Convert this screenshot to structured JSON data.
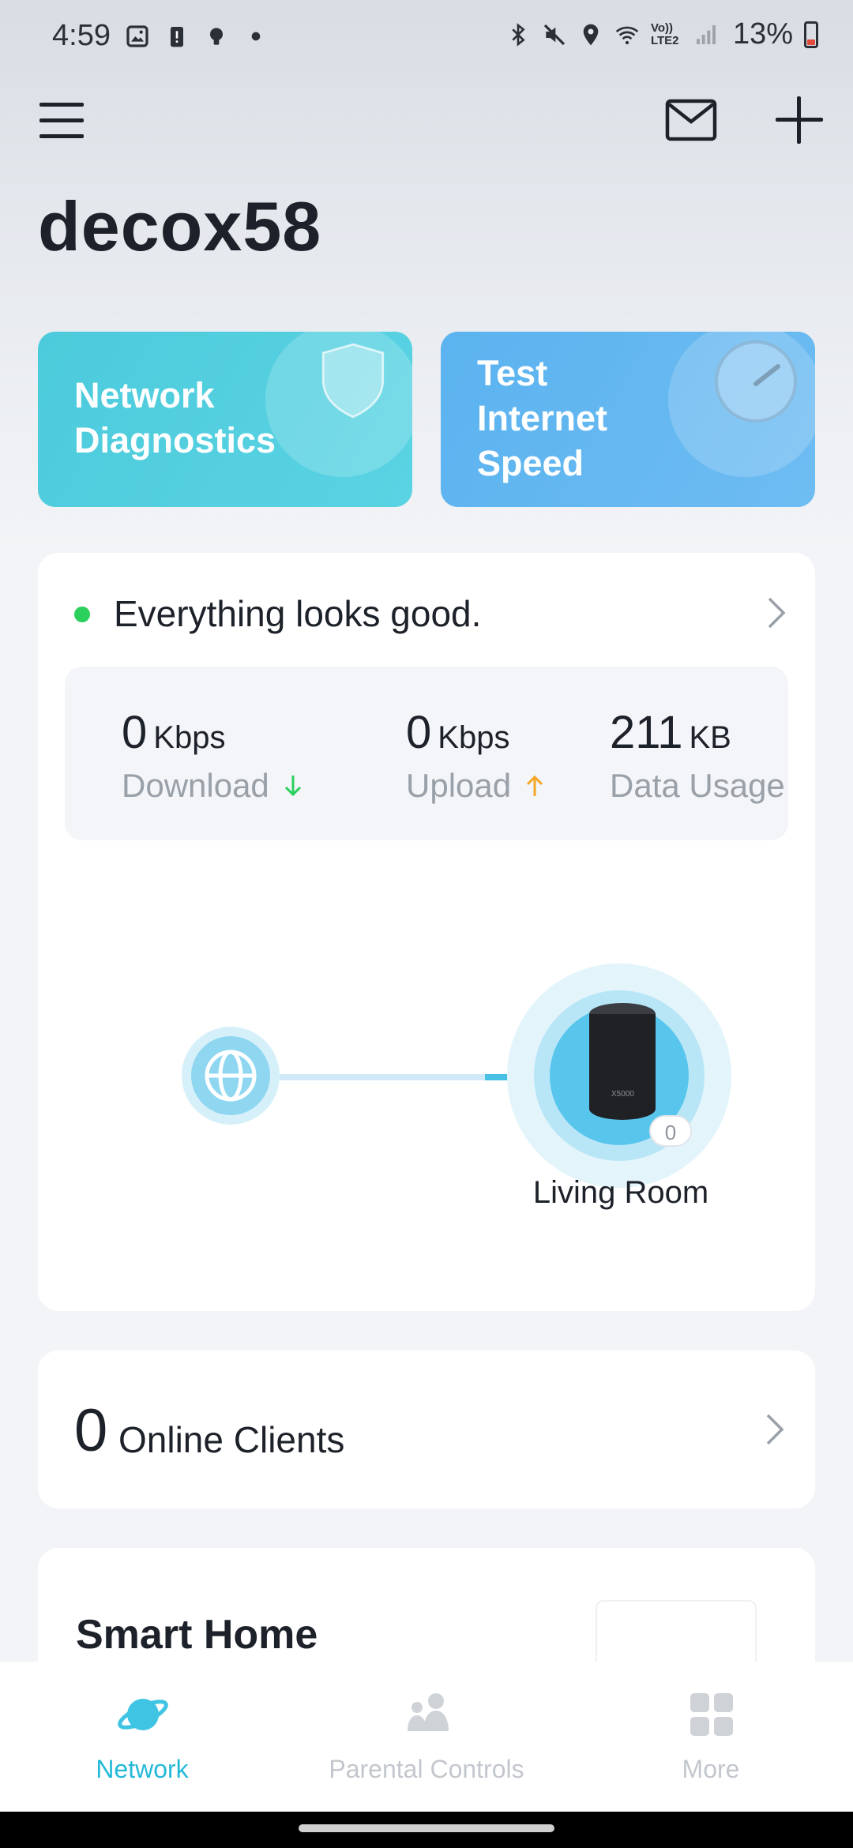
{
  "status_bar": {
    "time": "4:59",
    "battery": "13%",
    "left_icons": [
      "gallery-icon",
      "alert-icon",
      "bulb-icon",
      "dot-icon"
    ],
    "right_icons": [
      "bluetooth-icon",
      "mute-icon",
      "location-icon",
      "wifi-icon",
      "volte-icon",
      "signal-icon",
      "battery-icon"
    ],
    "volte_text": "Vo)) LTE2"
  },
  "header": {
    "title": "decox58",
    "menu_icon": "menu-icon",
    "mail_icon": "mail-icon",
    "add_icon": "add-icon"
  },
  "actions": {
    "diagnostics_label": "Network Diagnostics",
    "speed_label": "Test Internet Speed",
    "diagnostics_color": "#4ccbdc",
    "speed_color": "#5bb3ef"
  },
  "status": {
    "message": "Everything looks good.",
    "indicator_color": "#2bcf5c"
  },
  "stats": {
    "download": {
      "value": "0",
      "unit": "Kbps",
      "label": "Download"
    },
    "upload": {
      "value": "0",
      "unit": "Kbps",
      "label": "Upload"
    },
    "usage": {
      "value": "211",
      "unit": "KB",
      "label": "Data Usage"
    }
  },
  "topology": {
    "router_name": "Living Room",
    "router_clients": "0",
    "router_model_text": "X5000"
  },
  "clients": {
    "count": "0",
    "label": "Online Clients"
  },
  "smart_home": {
    "title": "Smart Home"
  },
  "nav": {
    "items": [
      {
        "label": "Network",
        "active": true
      },
      {
        "label": "Parental Controls",
        "active": false
      },
      {
        "label": "More",
        "active": false
      }
    ],
    "accent": "#25b9d8"
  }
}
